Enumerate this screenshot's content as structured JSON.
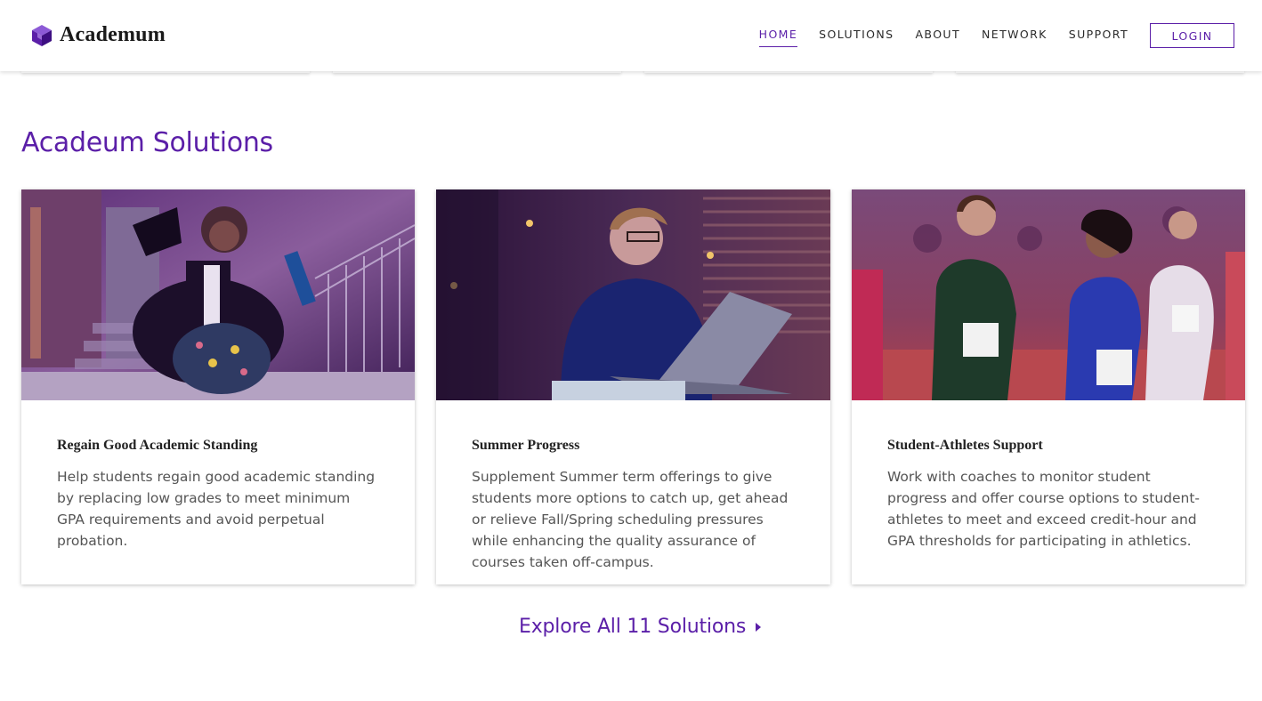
{
  "header": {
    "logo_text": "Academum",
    "nav": [
      "HOME",
      "SOLUTIONS",
      "ABOUT",
      "NETWORK",
      "SUPPORT"
    ],
    "active_nav": "HOME",
    "login_label": "LOGIN"
  },
  "section": {
    "title": "Acadeum Solutions",
    "cards": [
      {
        "title": "Regain Good Academic Standing",
        "description": "Help students regain good academic standing by replacing low grades to meet minimum GPA requirements and avoid perpetual probation.",
        "image": "graduate-celebrating-photo"
      },
      {
        "title": "Summer Progress",
        "description": "Supplement Summer term offerings to give students more options to catch up, get ahead or relieve Fall/Spring scheduling pressures while enhancing the quality assurance of courses taken off-campus.",
        "image": "student-with-laptop-photo"
      },
      {
        "title": "Student-Athletes Support",
        "description": "Work with coaches to monitor student progress and offer course options to student-athletes to meet and exceed credit-hour and GPA thresholds for participating in athletics.",
        "image": "track-runners-photo"
      }
    ],
    "explore_label": "Explore All 11 Solutions"
  },
  "colors": {
    "brand": "#5b1fa8",
    "text": "#555555",
    "heading": "#222222"
  }
}
